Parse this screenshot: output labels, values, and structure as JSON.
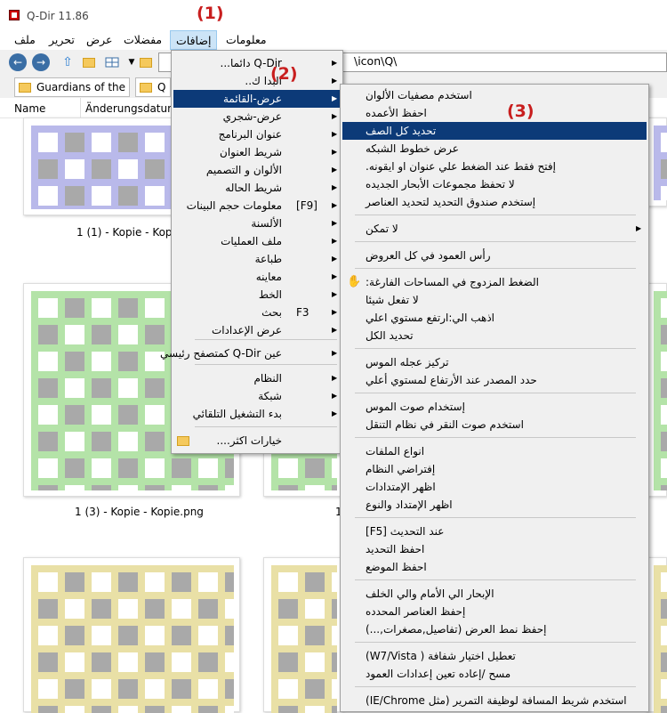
{
  "window": {
    "title": "Q-Dir 11.86"
  },
  "menubar": {
    "file": "ملف",
    "edit": "تحرير",
    "view": "عرض",
    "favorites": "مفضلات",
    "extras": "إضافات",
    "info": "معلومات"
  },
  "address": {
    "path": "\\icon\\Q\\"
  },
  "tabs": [
    {
      "label": "Guardians of the ..."
    },
    {
      "label": "Q"
    }
  ],
  "columns": {
    "name": "Name",
    "date": "Änderungsdatum"
  },
  "files": [
    {
      "caption": "1 (1) - Kopie - Kopie.",
      "color": "#b9b9ea"
    },
    {
      "caption": "1 (3) - Kopie - Kopie.png",
      "color": "#b4e3a8"
    },
    {
      "caption": "1",
      "color": "#e9e0a6"
    },
    {
      "caption": "",
      "color": "#e9e0a6"
    }
  ],
  "annotations": {
    "badge1": "(1)",
    "badge2": "(2)",
    "badge3": "(3)"
  },
  "menu1": {
    "items": [
      {
        "label": "Q-Dir دائما...",
        "shortcut": ""
      },
      {
        "label": "البدا ك..",
        "shortcut": ""
      },
      {
        "label": "عرض-القائمة",
        "shortcut": ""
      },
      {
        "label": "عرض-شجري",
        "shortcut": ""
      },
      {
        "label": "عنوان البرنامج",
        "shortcut": ""
      },
      {
        "label": "شريط العنوان",
        "shortcut": ""
      },
      {
        "label": "الألوان و التصميم",
        "shortcut": ""
      },
      {
        "label": "شريط الحاله",
        "shortcut": ""
      },
      {
        "label": "معلومات حجم البينات",
        "shortcut": "[F9]"
      },
      {
        "label": "الألسنة",
        "shortcut": ""
      },
      {
        "label": "ملف العمليات",
        "shortcut": ""
      },
      {
        "label": "طباعة",
        "shortcut": ""
      },
      {
        "label": "معاينه",
        "shortcut": ""
      },
      {
        "label": "الخط",
        "shortcut": ""
      },
      {
        "label": "بحث",
        "shortcut": "F3"
      },
      {
        "label": "عرض الإعدادات",
        "shortcut": ""
      },
      {
        "label": "عين Q-Dir كمتصفح رئيسي",
        "shortcut": ""
      },
      {
        "label": "النظام",
        "shortcut": ""
      },
      {
        "label": "شبكة",
        "shortcut": ""
      },
      {
        "label": "بدء التشغيل التلقائي",
        "shortcut": ""
      },
      {
        "label": "خيارات اكثر....",
        "shortcut": ""
      }
    ]
  },
  "menu2": {
    "items": [
      {
        "label": "استخدم مصفيات الألوان"
      },
      {
        "label": "احفظ الأعمده"
      },
      {
        "label": "تحديد كل الصف"
      },
      {
        "label": "عرض خطوط الشبكه"
      },
      {
        "label": "إفتح فقط عند الضغط علي عنوان او ايقونه."
      },
      {
        "label": "لا تحفظ مجموعات الأبحار الجديده"
      },
      {
        "label": "إستخدم صندوق التحديد لتحديد العناصر"
      },
      {
        "label": "لا تمكن"
      },
      {
        "label": "رأس العمود في كل العروض"
      },
      {
        "label": "الضغط المزدوج في المساحات الفارغة:"
      },
      {
        "label": "لا تفعل شيئا"
      },
      {
        "label": "اذهب الي:ارتفع مستوي اعلي"
      },
      {
        "label": "تحديد الكل"
      },
      {
        "label": "تركيز عجله الموس"
      },
      {
        "label": "حدد المصدر عند الأرتفاع لمستوي أعلي"
      },
      {
        "label": "إستخدام صوت الموس"
      },
      {
        "label": "استخدم صوت النقر في نظام التنقل"
      },
      {
        "label": "انواع الملفات"
      },
      {
        "label": "إفتراضي النظام"
      },
      {
        "label": "اظهر الإمتدادات"
      },
      {
        "label": "اظهر الإمتداد والنوع"
      },
      {
        "label": "عند التحديث [F5]"
      },
      {
        "label": "احفظ التحديد"
      },
      {
        "label": "احفظ الموضع"
      },
      {
        "label": "الإبحار الي الأمام والي الخلف"
      },
      {
        "label": "إحفظ العناصر المحدده"
      },
      {
        "label": "إحفظ نمط العرض (تفاصيل,مصغرات,...)"
      },
      {
        "label": "تعطيل اختيار شفافة ( W7/Vista)"
      },
      {
        "label": "مسح /إعاده تعين إعدادات العمود"
      },
      {
        "label": "استخدم شريط المسافة لوظيفة التمرير (مثل IE/Chrome)"
      }
    ]
  }
}
